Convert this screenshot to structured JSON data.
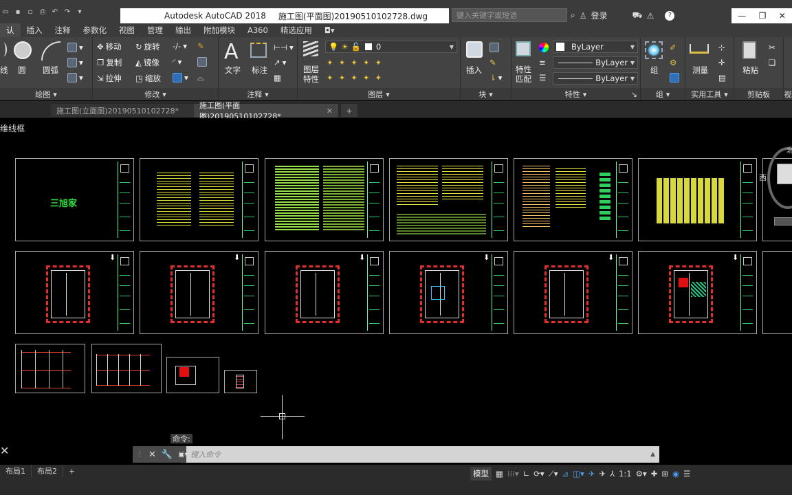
{
  "titlebar": {
    "app_name": "Autodesk AutoCAD 2018",
    "file_name": "施工图(平面图)20190510102728.dwg",
    "search_placeholder": "键入关键字或短语",
    "login_label": "登录"
  },
  "menu": {
    "tabs": [
      "认",
      "插入",
      "注释",
      "参数化",
      "视图",
      "管理",
      "输出",
      "附加模块",
      "A360",
      "精选应用"
    ],
    "active_index": 0
  },
  "ribbon": {
    "draw": {
      "title": "绘图",
      "line": "线",
      "circle": "圆",
      "arc": "圆弧"
    },
    "modify": {
      "title": "修改",
      "move": "移动",
      "rotate": "旋转",
      "copy": "复制",
      "mirror": "镜像",
      "stretch": "拉伸",
      "scale": "缩放"
    },
    "annotation": {
      "title": "注释",
      "text": "文字",
      "dimension": "标注"
    },
    "layers": {
      "title": "图层",
      "layer_props": "图层\n特性",
      "current_layer": "0"
    },
    "block": {
      "title": "块",
      "insert": "插入"
    },
    "properties": {
      "title": "特性",
      "match": "特性\n匹配",
      "color": "ByLayer",
      "linetype": "ByLayer",
      "lineweight": "ByLayer"
    },
    "groups": {
      "title": "组",
      "group": "组"
    },
    "utilities": {
      "title": "实用工具",
      "measure": "测量"
    },
    "clipboard": {
      "title": "剪贴板",
      "paste": "粘贴"
    },
    "view_title_partial": "视"
  },
  "doc_tabs": [
    {
      "label": "施工图(立面图)20190510102728*",
      "active": false
    },
    {
      "label": "施工图(平面图)20190510102728*",
      "active": true
    }
  ],
  "viewport": {
    "view_label": "维线框",
    "viewcube_north": "北",
    "viewcube_west": "西",
    "logo_text": "三旭家"
  },
  "command": {
    "label": "命令:",
    "placeholder": "键入命令"
  },
  "layout_tabs": [
    "布局1",
    "布局2"
  ],
  "statusbar": {
    "model_label": "模型",
    "scale_label": "1:1"
  },
  "colors": {
    "ribbon_bg": "#434343",
    "title_bg": "#3b3b3b",
    "canvas_bg": "#000000",
    "accent_blue": "#2f6fb7",
    "plan_wall_red": "#e0302a",
    "text_yellow": "#e8e83a"
  }
}
